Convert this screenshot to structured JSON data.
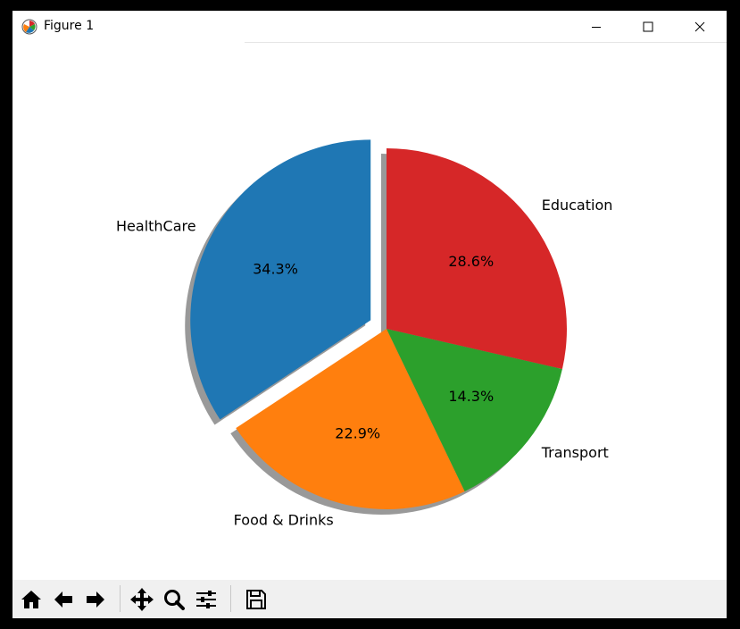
{
  "window": {
    "title": "Figure 1",
    "minimize_icon": "minimize-icon",
    "maximize_icon": "maximize-icon",
    "close_icon": "close-icon"
  },
  "chart_data": {
    "type": "pie",
    "labels": [
      "HealthCare",
      "Food & Drinks",
      "Transport",
      "Education"
    ],
    "values": [
      34.3,
      22.9,
      14.3,
      28.6
    ],
    "pct_labels": [
      "34.3%",
      "22.9%",
      "14.3%",
      "28.6%"
    ],
    "colors": [
      "#1f77b4",
      "#ff7f0e",
      "#2ca02c",
      "#d62728"
    ],
    "explode": [
      0.1,
      0,
      0,
      0
    ],
    "start_angle_deg": 90,
    "shadow": true
  },
  "toolbar": {
    "buttons": [
      "home-icon",
      "back-arrow-icon",
      "forward-arrow-icon",
      "pan-icon",
      "zoom-icon",
      "configure-subplots-icon",
      "save-icon"
    ]
  }
}
